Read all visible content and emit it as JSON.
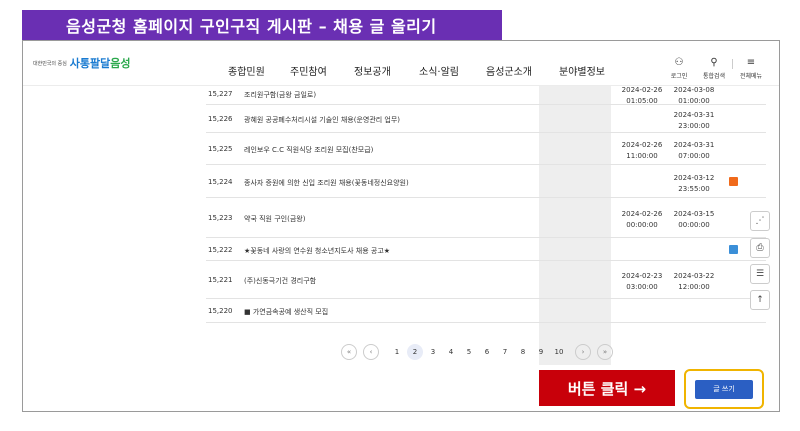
{
  "banner": {
    "title": "음성군청 홈페이지 구인구직 게시판 – 채용 글 올리기"
  },
  "header": {
    "logo_slogan": "대한민국의 중심",
    "logo_main_a": "사통팔달",
    "logo_main_b": "음성",
    "nav": [
      "종합민원",
      "주민참여",
      "정보공개",
      "소식·알림",
      "음성군소개",
      "분야별정보"
    ],
    "utils": [
      {
        "icon": "person-icon",
        "glyph": "⚇",
        "label": "로그인"
      },
      {
        "icon": "search-icon",
        "glyph": "⚲",
        "label": "통합검색"
      },
      {
        "icon": "menu-icon",
        "glyph": "≡",
        "label": "전체메뉴"
      }
    ]
  },
  "posts": [
    {
      "num": "15,227",
      "title": "조리원구함(금왕 금일로)",
      "date1": "2024-02-26\n01:05:00",
      "date2": "2024-03-08\n01:00:00",
      "file": ""
    },
    {
      "num": "15,226",
      "title": "광혜원 공공폐수처리시설 기술인 채용(운영관리 업무)",
      "date1": "",
      "date2": "2024-03-31\n23:00:00",
      "file": ""
    },
    {
      "num": "15,225",
      "title": "레인보우 C.C 직원식당 조리원 모집(찬모급)",
      "date1": "2024-02-26\n11:00:00",
      "date2": "2024-03-31\n07:00:00",
      "file": ""
    },
    {
      "num": "15,224",
      "title": "종사자 증원에 의한 신입 조리원 채용(꽃동네정신요양원)",
      "date1": "",
      "date2": "2024-03-12\n23:55:00",
      "file": "hwp"
    },
    {
      "num": "15,223",
      "title": "약국 직원 구인(금왕)",
      "date1": "2024-02-26\n00:00:00",
      "date2": "2024-03-15\n00:00:00",
      "file": ""
    },
    {
      "num": "15,222",
      "title": "★꽃동네 사랑의 연수원 청소년지도사 채용 공고★",
      "date1": "",
      "date2": "",
      "file": "doc"
    },
    {
      "num": "15,221",
      "title": "(주)신동극기건 경리구함",
      "date1": "2024-02-23\n03:00:00",
      "date2": "2024-03-22\n12:00:00",
      "file": ""
    },
    {
      "num": "15,220",
      "title": "■ 가연금속공예 생산직 모집",
      "date1": "",
      "date2": "",
      "file": ""
    }
  ],
  "pagination": {
    "first": "«",
    "prev": "‹",
    "next": "›",
    "last": "»",
    "pages": [
      "1",
      "2",
      "3",
      "4",
      "5",
      "6",
      "7",
      "8",
      "9",
      "10"
    ],
    "current": "2"
  },
  "side_buttons": [
    {
      "icon": "share-icon",
      "glyph": "⋰"
    },
    {
      "icon": "print-icon",
      "glyph": "⎙"
    },
    {
      "icon": "comment-icon",
      "glyph": "☰"
    },
    {
      "icon": "top-arrow-icon",
      "glyph": "↑"
    }
  ],
  "cta": {
    "label": "버튼 클릭 →"
  },
  "write_button": {
    "label": "글 쓰기"
  },
  "colors": {
    "banner": "#6a2fb3",
    "cta": "#c8000a",
    "write": "#2b5fc3",
    "highlight": "#f0b400",
    "hwp": "#f06a1b",
    "doc": "#3b8fd8"
  }
}
